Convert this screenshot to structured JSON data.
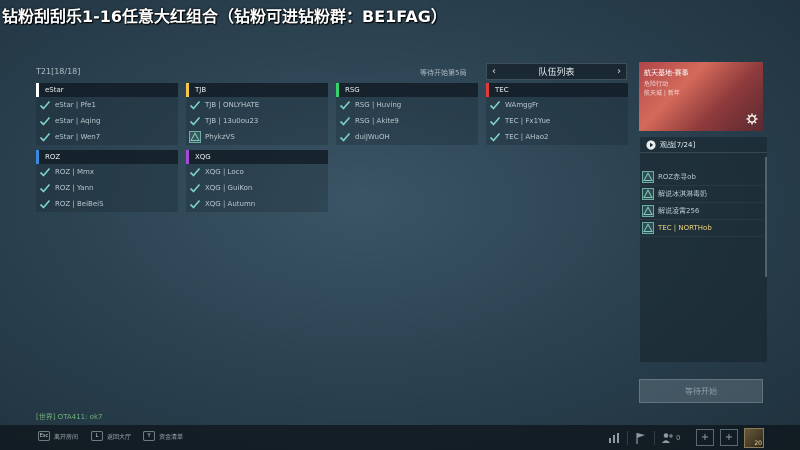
{
  "banner": "钻粉刮刮乐1-16任意大红组合（钻粉可进钻粉群：BE1FAG）",
  "room": {
    "id": "T21[18/18]",
    "wait_text": "等待开始第5局"
  },
  "roster": {
    "title": "队伍列表"
  },
  "teams": [
    {
      "name": "eStar",
      "color": "#ffffff",
      "members": [
        {
          "name": "eStar | Pfe1",
          "status": "ready"
        },
        {
          "name": "eStar | Aqing",
          "status": "ready"
        },
        {
          "name": "eStar | Wen7",
          "status": "ready"
        }
      ]
    },
    {
      "name": "TJB",
      "color": "#f1c84a",
      "members": [
        {
          "name": "TJB | ONLYHATE",
          "status": "ready"
        },
        {
          "name": "TJB | 13u0ou23",
          "status": "ready"
        },
        {
          "name": "PhykzVS",
          "status": "warn"
        }
      ]
    },
    {
      "name": "RSG",
      "color": "#36d36a",
      "members": [
        {
          "name": "RSG | Huving",
          "status": "ready"
        },
        {
          "name": "RSG | Akite9",
          "status": "ready"
        },
        {
          "name": "duiJWuOH",
          "status": "ready"
        }
      ]
    },
    {
      "name": "TEC",
      "color": "#e03a3a",
      "members": [
        {
          "name": "WAmggFr",
          "status": "ready"
        },
        {
          "name": "TEC | Fx1Yue",
          "status": "ready"
        },
        {
          "name": "TEC | AHao2",
          "status": "ready"
        }
      ]
    },
    {
      "name": "ROZ",
      "color": "#3a8ae0",
      "members": [
        {
          "name": "ROZ | Mmx",
          "status": "ready"
        },
        {
          "name": "ROZ | Yann",
          "status": "ready"
        },
        {
          "name": "ROZ | BeiBeiS",
          "status": "ready"
        }
      ]
    },
    {
      "name": "XQG",
      "color": "#a64ad6",
      "members": [
        {
          "name": "XQG | Loco",
          "status": "ready"
        },
        {
          "name": "XQG | GuiKon",
          "status": "ready"
        },
        {
          "name": "XQG | Autumn",
          "status": "ready"
        }
      ]
    }
  ],
  "preview": {
    "title": "航天基地-赛事",
    "line1": "危险行动",
    "line2": "航天城 | 新年"
  },
  "spectators": {
    "title": "观战[7/24]",
    "items": [
      {
        "name": "ROZ赤寻ob",
        "active": false
      },
      {
        "name": "解说冰淇淋毒奶",
        "active": false
      },
      {
        "name": "解说凌霄256",
        "active": false
      },
      {
        "name": "TEC | NORTHob",
        "active": true
      }
    ]
  },
  "start_button": "等待开始",
  "chat": "[世界] OTA411: ok7",
  "bottom": {
    "hints": [
      {
        "key": "Esc",
        "label": "离开房间"
      },
      {
        "key": "L",
        "label": "返回大厅"
      },
      {
        "key": "Y",
        "label": "资金清单"
      }
    ],
    "friend_count": "0",
    "avatar_level": "20"
  },
  "colors": {
    "check": "#7fd3c8",
    "warn": "#7fc9b8",
    "active_spec": "#e9d07a"
  }
}
